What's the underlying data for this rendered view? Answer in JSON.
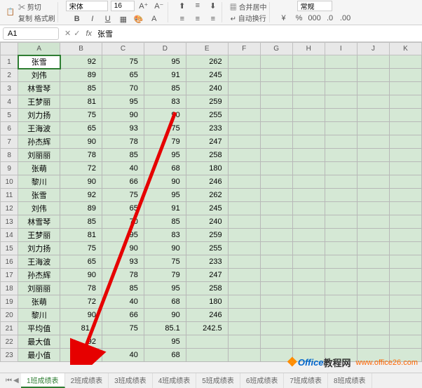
{
  "ribbon": {
    "paste": "粘贴",
    "cut": "剪切",
    "copy": "复制",
    "format_painter": "格式刷",
    "font_name": "宋体",
    "font_size": "16",
    "merge": "合并居中",
    "wrap": "自动换行",
    "number_format": "常规"
  },
  "namebox": {
    "value": "A1"
  },
  "formula": {
    "value": "张雪"
  },
  "columns": [
    "A",
    "B",
    "C",
    "D",
    "E",
    "F",
    "G",
    "H",
    "I",
    "J",
    "K"
  ],
  "rows": [
    {
      "r": 1,
      "name": "张雪",
      "b": 92,
      "c": 75,
      "d": 95,
      "e": 262
    },
    {
      "r": 2,
      "name": "刘伟",
      "b": 89,
      "c": 65,
      "d": 91,
      "e": 245
    },
    {
      "r": 3,
      "name": "林雪琴",
      "b": 85,
      "c": 70,
      "d": 85,
      "e": 240
    },
    {
      "r": 4,
      "name": "王梦丽",
      "b": 81,
      "c": 95,
      "d": 83,
      "e": 259
    },
    {
      "r": 5,
      "name": "刘力扬",
      "b": 75,
      "c": 90,
      "d": 90,
      "e": 255
    },
    {
      "r": 6,
      "name": "王海波",
      "b": 65,
      "c": 93,
      "d": 75,
      "e": 233
    },
    {
      "r": 7,
      "name": "孙杰辉",
      "b": 90,
      "c": 78,
      "d": 79,
      "e": 247
    },
    {
      "r": 8,
      "name": "刘丽丽",
      "b": 78,
      "c": 85,
      "d": 95,
      "e": 258
    },
    {
      "r": 9,
      "name": "张萌",
      "b": 72,
      "c": 40,
      "d": 68,
      "e": 180
    },
    {
      "r": 10,
      "name": "黎川",
      "b": 90,
      "c": 66,
      "d": 90,
      "e": 246
    },
    {
      "r": 11,
      "name": "张雪",
      "b": 92,
      "c": 75,
      "d": 95,
      "e": 262
    },
    {
      "r": 12,
      "name": "刘伟",
      "b": 89,
      "c": 65,
      "d": 91,
      "e": 245
    },
    {
      "r": 13,
      "name": "林雪琴",
      "b": 85,
      "c": 70,
      "d": 85,
      "e": 240
    },
    {
      "r": 14,
      "name": "王梦丽",
      "b": 81,
      "c": 95,
      "d": 83,
      "e": 259
    },
    {
      "r": 15,
      "name": "刘力扬",
      "b": 75,
      "c": 90,
      "d": 90,
      "e": 255
    },
    {
      "r": 16,
      "name": "王海波",
      "b": 65,
      "c": 93,
      "d": 75,
      "e": 233
    },
    {
      "r": 17,
      "name": "孙杰辉",
      "b": 90,
      "c": 78,
      "d": 79,
      "e": 247
    },
    {
      "r": 18,
      "name": "刘丽丽",
      "b": 78,
      "c": 85,
      "d": 95,
      "e": 258
    },
    {
      "r": 19,
      "name": "张萌",
      "b": 72,
      "c": 40,
      "d": 68,
      "e": 180
    },
    {
      "r": 20,
      "name": "黎川",
      "b": 90,
      "c": 66,
      "d": 90,
      "e": 246
    },
    {
      "r": 21,
      "name": "平均值",
      "b": 81.7,
      "c": 75,
      "d": 85.1,
      "e": 242.5
    },
    {
      "r": 22,
      "name": "最大值",
      "b": 92,
      "c": "",
      "d": 95,
      "e": ""
    },
    {
      "r": 23,
      "name": "最小值",
      "b": "",
      "c": 40,
      "d": 68,
      "e": ""
    }
  ],
  "tabs": [
    "1班成绩表",
    "2班成绩表",
    "3班成绩表",
    "4班成绩表",
    "5班成绩表",
    "6班成绩表",
    "7班成绩表",
    "8班成绩表"
  ],
  "watermark": {
    "brand": "Office",
    "suffix": "教程网",
    "url": "www.office26.com"
  }
}
